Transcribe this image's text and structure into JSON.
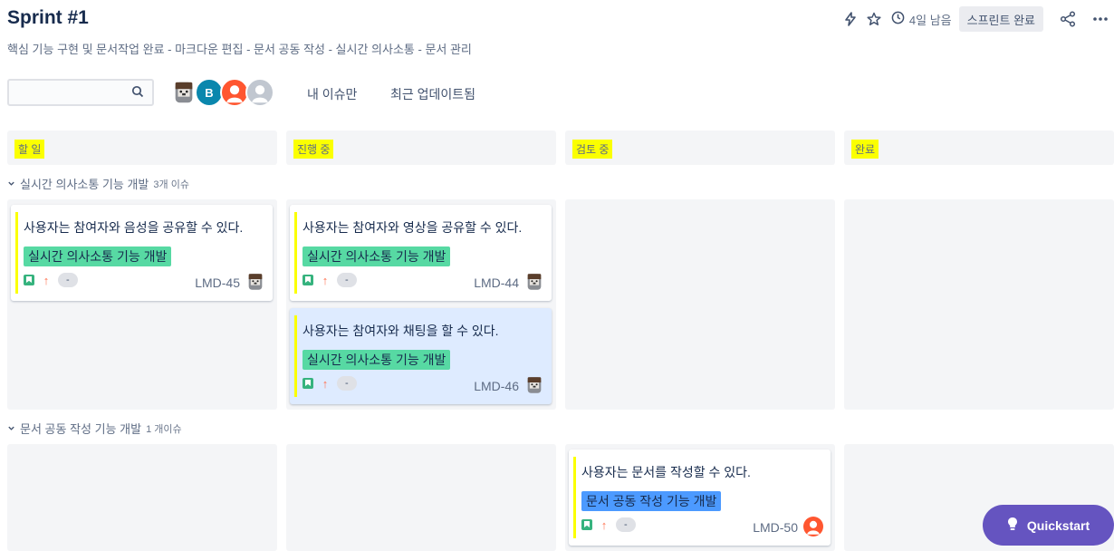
{
  "header": {
    "title": "Sprint #1",
    "subtitle": "핵심 기능 구현 및 문서작업 완료 - 마크다운 편집 - 문서 공동 작성 - 실시간 의사소통 - 문서 관리",
    "time_left": "4일 남음",
    "complete_label": "스프린트 완료",
    "icons": [
      "lightning-icon",
      "star-icon",
      "clock-icon",
      "share-icon",
      "more-icon"
    ]
  },
  "filters": {
    "search_placeholder": "",
    "avatar_b_initial": "B",
    "only_my_issues": "내 이슈만",
    "recently_updated": "최근 업데이트됨"
  },
  "columns": [
    {
      "label": "할 일"
    },
    {
      "label": "진행 중"
    },
    {
      "label": "검토 중"
    },
    {
      "label": "완료"
    }
  ],
  "swimlanes": [
    {
      "name": "실시간 의사소통 기능 개발",
      "count": "3개 이슈",
      "cards": [
        {
          "summary": "사용자는 참여자와 음성을 공유할 수 있다.",
          "epic": "실시간 의사소통 기능 개발",
          "estimate": "-",
          "key": "LMD-45"
        },
        {
          "summary": "사용자는 참여자와 영상을 공유할 수 있다.",
          "epic": "실시간 의사소통 기능 개발",
          "estimate": "-",
          "key": "LMD-44"
        },
        {
          "summary": "사용자는 참여자와 채팅을 할 수 있다.",
          "epic": "실시간 의사소통 기능 개발",
          "estimate": "-",
          "key": "LMD-46"
        }
      ]
    },
    {
      "name": "문서 공동 작성 기능 개발",
      "count": "1 개이슈",
      "cards": [
        {
          "summary": "사용자는 문서를 작성할 수 있다.",
          "epic": "문서 공동 작성 기능 개발",
          "estimate": "-",
          "key": "LMD-50"
        }
      ]
    }
  ],
  "quickstart_label": "Quickstart",
  "colors": {
    "highlight": "#fbff00",
    "epic_green": "#57d9a3",
    "epic_blue": "#4c9aff",
    "quickstart": "#6554c0",
    "story": "#36b37e",
    "priority": "#ff7452"
  }
}
